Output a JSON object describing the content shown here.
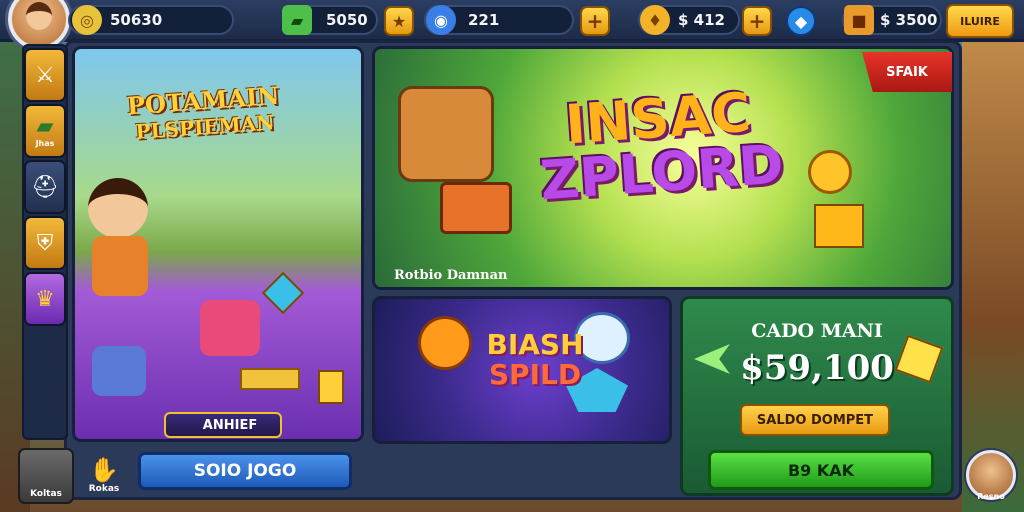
{
  "top_bar": {
    "gold": "50630",
    "cash": "5050",
    "energy": "221",
    "keys": "$ 412",
    "chests": "$ 3500",
    "shop_button": "ILUIRE"
  },
  "sidebar": {
    "items": [
      {
        "icon": "sword-icon",
        "label": ""
      },
      {
        "icon": "cash-icon",
        "label": "Jhas"
      },
      {
        "icon": "helmet-icon",
        "label": ""
      },
      {
        "icon": "shield-icon",
        "label": ""
      },
      {
        "icon": "trophy-icon",
        "label": ""
      }
    ]
  },
  "left_panel": {
    "title_line1": "POTAMAIN",
    "title_line2": "PLSPIEMAN",
    "achievement": "ANHIEF"
  },
  "featured_panel": {
    "ribbon": "SFAIK",
    "title_line1": "INSAC",
    "title_line2": "ZPLORD",
    "caption": "Rotbio Damnan"
  },
  "bottom_panel": {
    "title_line1": "BIASH",
    "title_line2": "SPILD"
  },
  "offer_panel": {
    "title": "CADO MANI",
    "price": "$59,100",
    "secondary_button": "SALDO DOMPET",
    "primary_button": "B9 KAK"
  },
  "bottom_bar": {
    "play_button": "SOIO JOGO",
    "gloves_label": "Rokas",
    "left_button_label": "Koltas",
    "friend_label": "Resno"
  }
}
